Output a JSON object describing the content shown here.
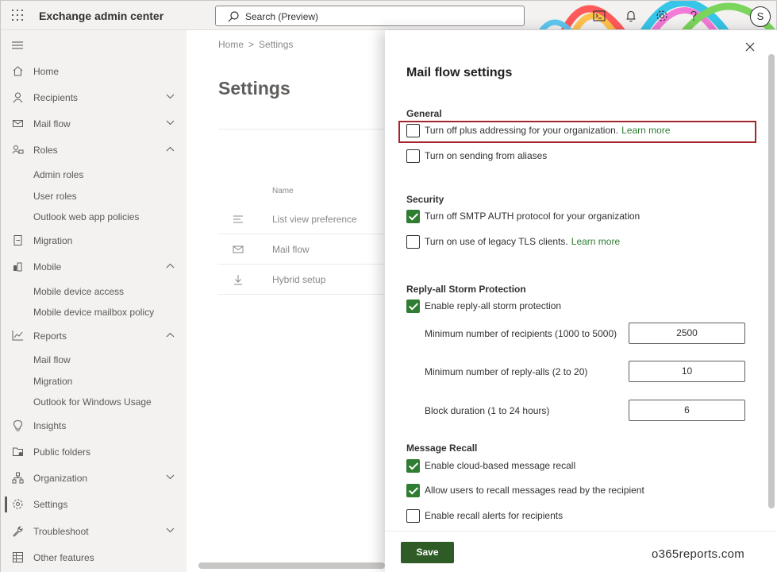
{
  "app": {
    "title": "Exchange admin center",
    "search_placeholder": "Search (Preview)",
    "avatar_initial": "S"
  },
  "nav": {
    "items": [
      {
        "label": "Home",
        "icon": "home-icon"
      },
      {
        "label": "Recipients",
        "icon": "person-icon",
        "chevron": "down"
      },
      {
        "label": "Mail flow",
        "icon": "mail-icon",
        "chevron": "down"
      },
      {
        "label": "Roles",
        "icon": "roles-icon",
        "chevron": "up"
      },
      {
        "label": "Migration",
        "icon": "migration-icon"
      },
      {
        "label": "Mobile",
        "icon": "mobile-icon",
        "chevron": "up"
      },
      {
        "label": "Reports",
        "icon": "chart-icon",
        "chevron": "up"
      },
      {
        "label": "Insights",
        "icon": "lightbulb-icon"
      },
      {
        "label": "Public folders",
        "icon": "folder-icon"
      },
      {
        "label": "Organization",
        "icon": "org-icon",
        "chevron": "down"
      },
      {
        "label": "Settings",
        "icon": "gear-icon"
      },
      {
        "label": "Troubleshoot",
        "icon": "wrench-icon",
        "chevron": "down"
      },
      {
        "label": "Other features",
        "icon": "grid-icon"
      }
    ],
    "roles_sub": [
      "Admin roles",
      "User roles",
      "Outlook web app policies"
    ],
    "mobile_sub": [
      "Mobile device access",
      "Mobile device mailbox policy"
    ],
    "reports_sub": [
      "Mail flow",
      "Migration",
      "Outlook for Windows Usage"
    ]
  },
  "main": {
    "breadcrumb": [
      "Home",
      "Settings"
    ],
    "breadcrumb_sep": ">",
    "title": "Settings",
    "column_header": "Name",
    "rows": [
      {
        "label": "List view preference",
        "icon": "list-icon"
      },
      {
        "label": "Mail flow",
        "icon": "mail-icon"
      },
      {
        "label": "Hybrid setup",
        "icon": "download-icon"
      }
    ]
  },
  "panel": {
    "title": "Mail flow settings",
    "sections": {
      "general": "General",
      "security": "Security",
      "storm": "Reply-all Storm Protection",
      "recall": "Message Recall"
    },
    "checkboxes": {
      "plus_addressing": {
        "label": "Turn off plus addressing for your organization.",
        "link": "Learn more",
        "checked": false
      },
      "aliases": {
        "label": "Turn on sending from aliases",
        "checked": false
      },
      "smtp_auth": {
        "label": "Turn off SMTP AUTH protocol for your organization",
        "checked": true
      },
      "legacy_tls": {
        "label": "Turn on use of legacy TLS clients.",
        "link": "Learn more",
        "checked": false
      },
      "storm_protection": {
        "label": "Enable reply-all storm protection",
        "checked": true
      },
      "cloud_recall": {
        "label": "Enable cloud-based message recall",
        "checked": true
      },
      "recall_read": {
        "label": "Allow users to recall messages read by the recipient",
        "checked": true
      },
      "recall_alerts": {
        "label": "Enable recall alerts for recipients",
        "checked": false
      }
    },
    "fields": {
      "min_recipients": {
        "label": "Minimum number of recipients (1000 to 5000)",
        "value": "2500"
      },
      "min_replyalls": {
        "label": "Minimum number of reply-alls (2 to 20)",
        "value": "10"
      },
      "block_duration": {
        "label": "Block duration (1 to 24 hours)",
        "value": "6"
      }
    },
    "save_label": "Save",
    "watermark": "o365reports.com"
  },
  "colors": {
    "accent_green": "#2f7d32",
    "save_green": "#2f5b27",
    "highlight_red": "#a4262c"
  }
}
